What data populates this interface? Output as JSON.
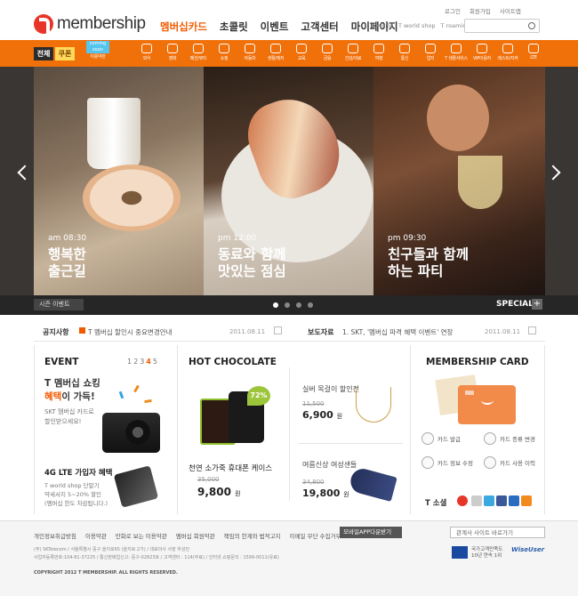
{
  "header": {
    "logo_text": "membership",
    "nav": [
      "멤버십카드",
      "초콜릿",
      "이벤트",
      "고객센터",
      "마이페이지"
    ],
    "top_links": [
      "로그인",
      "회원가입",
      "사이트맵"
    ],
    "site_links": [
      "T world",
      "T world shop",
      "T roaming"
    ]
  },
  "catbar": {
    "all_label": "전체",
    "coupon_label": "쿠폰",
    "coming_label": "coming soon",
    "items": [
      "이용약관",
      "외식",
      "영화",
      "패션/뷰티",
      "쇼핑",
      "자동차",
      "생활/레저",
      "교육",
      "금융",
      "건강/의료",
      "여행",
      "통신",
      "업저",
      "T 생활서비스",
      "VIP이용자",
      "레스트/지켜",
      "LTE"
    ]
  },
  "hero": {
    "panels": [
      {
        "time": "am 08:30",
        "caption": "행복한\n출근길"
      },
      {
        "time": "pm 12:00",
        "caption": "동료와 함께\n맛있는 점심"
      },
      {
        "time": "pm 09:30",
        "caption": "친구들과 함께\n하는 파티"
      }
    ],
    "season_label": "시즌 이벤트",
    "special_label": "SPECIAL",
    "special_plus": "+"
  },
  "notice": {
    "label": "공지사항",
    "text": "T 멤버십 할인시 중요변경안내",
    "date": "2011.08.11",
    "press_label": "보도자료",
    "press_text": "1. SKT, '멤버십 파격 혜택 이벤트' 연장",
    "press_date": "2011.08.11"
  },
  "event": {
    "title": "EVENT",
    "pages": [
      "1",
      "2",
      "3",
      "4",
      "5"
    ],
    "headline_a": "T 멤버십 쇼킹",
    "headline_b": "혜택",
    "headline_c": "이 가득!",
    "sub": "SKT 멤버십 카드로\n할인받으세요!",
    "lte_title": "4G LTE 가입자 혜택",
    "lte_sub": "T world shop 단말기\n약세서지 5~20% 할인\n(멤버십 한도 차감됩니다.)"
  },
  "hot": {
    "title": "HOT CHOCOLATE",
    "case_name": "천연 소가죽 휴대폰 케이스",
    "case_old": "35,000",
    "case_new": "9,800",
    "case_pct": "72%",
    "neck_name": "실버 목걸이 할인전",
    "neck_old": "11,500",
    "neck_new": "6,900",
    "shoe_name": "여름신상 여성샌들",
    "shoe_old": "34,800",
    "shoe_new": "19,800",
    "won": "원"
  },
  "card": {
    "title": "MEMBERSHIP CARD",
    "menu": [
      "카드 발급",
      "카드 종류 변경",
      "카드 정보 수정",
      "카드 사용 이력"
    ],
    "social_label": "T 소셜"
  },
  "footer": {
    "links": [
      "개인정보취급방침",
      "이용약관",
      "만화로 보는 이용약관",
      "멤버십 회원약관",
      "책임의 한계와 법적고지",
      "이메일 무단 수집거부"
    ],
    "mobile_btn": "모바일APP다운받기",
    "related": "관계사 사이트 바로가기",
    "address": "(주) SKTelecom / 서울특별시 중구 을지로65 (을지로 2가) / 대표이사 사장 하성민\n사업자등록번호:104-81-37225 / 통신판매업신고: 중구-02823호 / 고객센터 : 114(무료) / 인터넷 쇼핑문의 : 1599-0011(유료)",
    "copyright": "COPYRIGHT 2012 T MEMBERSHIP. ALL RIGHTS RESERVED.",
    "ncsi_text": "국가고객만족도\n10년 연속 1위",
    "wise": "WiseUser"
  },
  "colors": {
    "accent": "#f0700a",
    "dark": "#262626",
    "green": "#9dc53b"
  }
}
